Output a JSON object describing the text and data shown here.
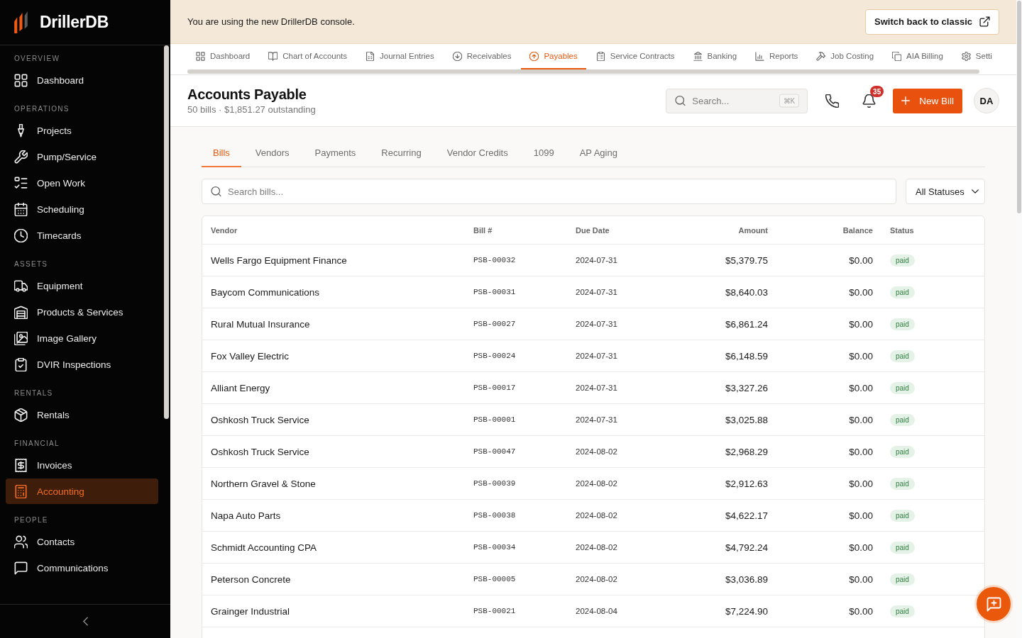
{
  "sidebar": {
    "brand": "DrillerDB",
    "sections": [
      {
        "label": "OVERVIEW",
        "items": [
          {
            "label": "Dashboard",
            "selected": false
          }
        ]
      },
      {
        "label": "OPERATIONS",
        "items": [
          {
            "label": "Projects",
            "selected": false
          },
          {
            "label": "Pump/Service",
            "selected": false
          },
          {
            "label": "Open Work",
            "selected": false
          },
          {
            "label": "Scheduling",
            "selected": false
          },
          {
            "label": "Timecards",
            "selected": false
          }
        ]
      },
      {
        "label": "ASSETS",
        "items": [
          {
            "label": "Equipment",
            "selected": false
          },
          {
            "label": "Products & Services",
            "selected": false
          },
          {
            "label": "Image Gallery",
            "selected": false
          },
          {
            "label": "DVIR Inspections",
            "selected": false
          }
        ]
      },
      {
        "label": "RENTALS",
        "items": [
          {
            "label": "Rentals",
            "selected": false
          }
        ]
      },
      {
        "label": "FINANCIAL",
        "items": [
          {
            "label": "Invoices",
            "selected": false
          },
          {
            "label": "Accounting",
            "selected": true
          }
        ]
      },
      {
        "label": "PEOPLE",
        "items": [
          {
            "label": "Contacts",
            "selected": false
          },
          {
            "label": "Communications",
            "selected": false
          }
        ]
      }
    ]
  },
  "banner": {
    "message": "You are using the new DrillerDB console.",
    "button": "Switch back to classic"
  },
  "module_tabs": [
    {
      "label": "Dashboard",
      "selected": false
    },
    {
      "label": "Chart of Accounts",
      "selected": false
    },
    {
      "label": "Journal Entries",
      "selected": false
    },
    {
      "label": "Receivables",
      "selected": false
    },
    {
      "label": "Payables",
      "selected": true
    },
    {
      "label": "Service Contracts",
      "selected": false
    },
    {
      "label": "Banking",
      "selected": false
    },
    {
      "label": "Reports",
      "selected": false
    },
    {
      "label": "Job Costing",
      "selected": false
    },
    {
      "label": "AIA Billing",
      "selected": false
    },
    {
      "label": "Setti",
      "selected": false
    }
  ],
  "header": {
    "title": "Accounts Payable",
    "subtitle": "50 bills · $1,851.27 outstanding",
    "search": {
      "placeholder": "Search...",
      "shortcut": "⌘K"
    },
    "notifications": {
      "count": "35"
    },
    "new_button": "New Bill",
    "avatar": "DA"
  },
  "tabs": [
    {
      "label": "Bills",
      "selected": true
    },
    {
      "label": "Vendors",
      "selected": false
    },
    {
      "label": "Payments",
      "selected": false
    },
    {
      "label": "Recurring",
      "selected": false
    },
    {
      "label": "Vendor Credits",
      "selected": false
    },
    {
      "label": "1099",
      "selected": false
    },
    {
      "label": "AP Aging",
      "selected": false
    }
  ],
  "filters": {
    "search": {
      "placeholder": "Search bills..."
    },
    "status": {
      "value": "All Statuses"
    }
  },
  "table": {
    "columns": [
      "Vendor",
      "Bill #",
      "Due Date",
      "Amount",
      "Balance",
      "Status"
    ],
    "rows": [
      {
        "vendor": "Wells Fargo Equipment Finance",
        "bill": "PSB-00032",
        "due_date": "2024-07-31",
        "amount": "$5,379.75",
        "balance": "$0.00",
        "status": "paid"
      },
      {
        "vendor": "Baycom Communications",
        "bill": "PSB-00031",
        "due_date": "2024-07-31",
        "amount": "$8,640.03",
        "balance": "$0.00",
        "status": "paid"
      },
      {
        "vendor": "Rural Mutual Insurance",
        "bill": "PSB-00027",
        "due_date": "2024-07-31",
        "amount": "$6,861.24",
        "balance": "$0.00",
        "status": "paid"
      },
      {
        "vendor": "Fox Valley Electric",
        "bill": "PSB-00024",
        "due_date": "2024-07-31",
        "amount": "$6,148.59",
        "balance": "$0.00",
        "status": "paid"
      },
      {
        "vendor": "Alliant Energy",
        "bill": "PSB-00017",
        "due_date": "2024-07-31",
        "amount": "$3,327.26",
        "balance": "$0.00",
        "status": "paid"
      },
      {
        "vendor": "Oshkosh Truck Service",
        "bill": "PSB-00001",
        "due_date": "2024-07-31",
        "amount": "$3,025.88",
        "balance": "$0.00",
        "status": "paid"
      },
      {
        "vendor": "Oshkosh Truck Service",
        "bill": "PSB-00047",
        "due_date": "2024-08-02",
        "amount": "$2,968.29",
        "balance": "$0.00",
        "status": "paid"
      },
      {
        "vendor": "Northern Gravel & Stone",
        "bill": "PSB-00039",
        "due_date": "2024-08-02",
        "amount": "$2,912.63",
        "balance": "$0.00",
        "status": "paid"
      },
      {
        "vendor": "Napa Auto Parts",
        "bill": "PSB-00038",
        "due_date": "2024-08-02",
        "amount": "$4,622.17",
        "balance": "$0.00",
        "status": "paid"
      },
      {
        "vendor": "Schmidt Accounting CPA",
        "bill": "PSB-00034",
        "due_date": "2024-08-02",
        "amount": "$4,792.24",
        "balance": "$0.00",
        "status": "paid"
      },
      {
        "vendor": "Peterson Concrete",
        "bill": "PSB-00005",
        "due_date": "2024-08-02",
        "amount": "$3,036.89",
        "balance": "$0.00",
        "status": "paid"
      },
      {
        "vendor": "Grainger Industrial",
        "bill": "PSB-00021",
        "due_date": "2024-08-04",
        "amount": "$7,224.90",
        "balance": "$0.00",
        "status": "paid"
      }
    ]
  }
}
